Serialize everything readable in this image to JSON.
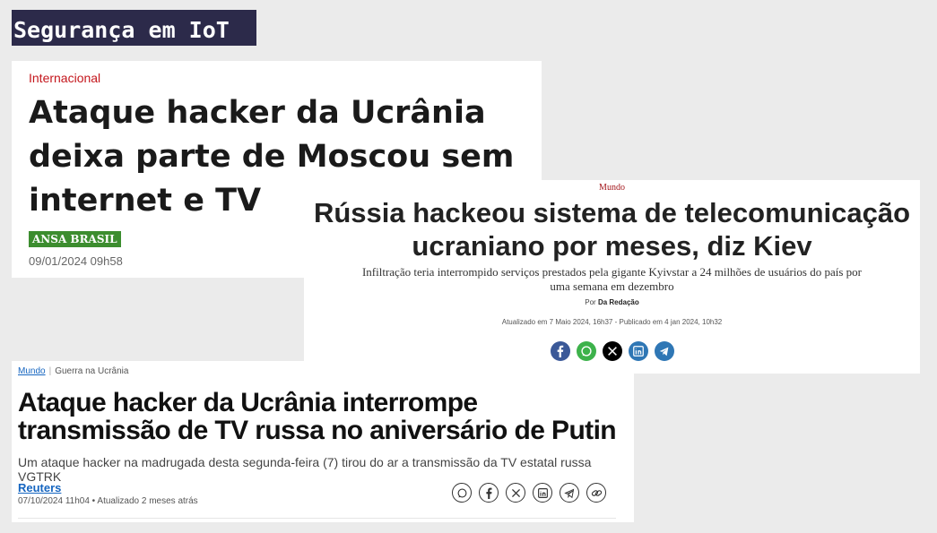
{
  "slide": {
    "title": "Segurança em IoT"
  },
  "card1": {
    "section": "Internacional",
    "headline": "Ataque hacker da Ucrânia deixa parte de Moscou sem internet e TV",
    "agency": "ANSA BRASIL",
    "datetime": "09/01/2024 09h58",
    "colors": {
      "section": "#c4161c",
      "agency_bg": "#3c8d2f"
    }
  },
  "card2": {
    "section": "Mundo",
    "headline": "Rússia hackeou sistema de telecomunicação ucraniano por meses, diz Kiev",
    "subtitle": "Infiltração teria interrompido serviços prestados pela gigante Kyivstar a 24 milhões de usuários do país por uma semana em dezembro",
    "byline_prefix": "Por",
    "byline_author": "Da Redação",
    "dates": "Atualizado em 7 Maio 2024, 16h37 - Publicado em 4 jan 2024, 10h32",
    "share_icons": [
      {
        "name": "facebook-icon",
        "color": "#3b5998"
      },
      {
        "name": "whatsapp-icon",
        "color": "#3db24b"
      },
      {
        "name": "x-icon",
        "color": "#000000"
      },
      {
        "name": "linkedin-icon",
        "color": "#2f77b5"
      },
      {
        "name": "telegram-icon",
        "color": "#2f77b5"
      }
    ]
  },
  "card3": {
    "breadcrumb_section": "Mundo",
    "breadcrumb_topic": "Guerra na Ucrânia",
    "headline": "Ataque hacker da Ucrânia interrompe transmissão de TV russa no aniversário de Putin",
    "subtitle": "Um ataque hacker na madrugada desta segunda-feira (7) tirou do ar a transmissão da TV estatal russa VGTRK",
    "source": "Reuters",
    "meta": "07/10/2024 11h04 • Atualizado 2 meses atrás",
    "share_icons": [
      "whatsapp-icon",
      "facebook-icon",
      "x-icon",
      "linkedin-icon",
      "telegram-icon",
      "link-icon"
    ],
    "colors": {
      "link": "#1565c0"
    }
  }
}
